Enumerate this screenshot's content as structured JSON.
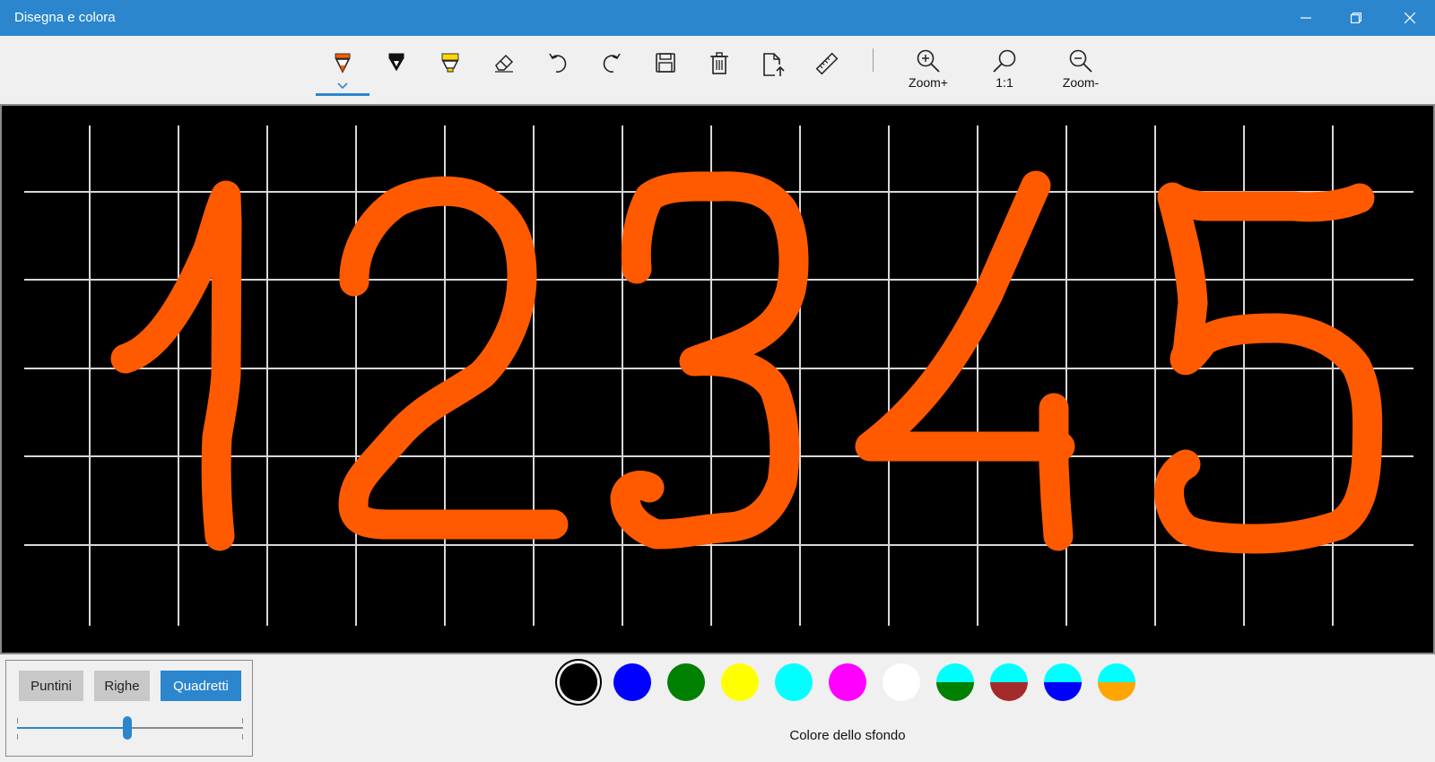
{
  "window": {
    "title": "Disegna e colora",
    "minimize_icon": "minimize-icon",
    "maximize_icon": "restore-icon",
    "close_icon": "close-icon"
  },
  "toolbar": {
    "tools": [
      {
        "name": "pen-tool",
        "icon": "orange-pen-icon",
        "active": true
      },
      {
        "name": "marker-tool",
        "icon": "black-marker-icon"
      },
      {
        "name": "highlighter-tool",
        "icon": "yellow-highlighter-icon"
      },
      {
        "name": "eraser-tool",
        "icon": "eraser-icon"
      },
      {
        "name": "undo-tool",
        "icon": "undo-icon"
      },
      {
        "name": "redo-tool",
        "icon": "redo-icon"
      },
      {
        "name": "save-tool",
        "icon": "save-icon"
      },
      {
        "name": "delete-tool",
        "icon": "trash-icon"
      },
      {
        "name": "export-tool",
        "icon": "file-export-icon"
      },
      {
        "name": "ruler-tool",
        "icon": "ruler-icon"
      }
    ],
    "zoom_in_label": "Zoom+",
    "zoom_reset_label": "1:1",
    "zoom_out_label": "Zoom-"
  },
  "canvas": {
    "background": "#000000",
    "grid_color": "#d8d8d8",
    "stroke_color": "#ff5a00",
    "drawn_digits": [
      "1",
      "2",
      "3",
      "4",
      "5"
    ]
  },
  "grid_panel": {
    "buttons": [
      {
        "label": "Puntini",
        "selected": false
      },
      {
        "label": "Righe",
        "selected": false
      },
      {
        "label": "Quadretti",
        "selected": true
      }
    ],
    "grid_size_slider_fraction": 0.49
  },
  "background_colors": {
    "caption": "Colore dello sfondo",
    "selected_index": 0,
    "swatches": [
      {
        "name": "black",
        "top": "#000000",
        "bottom": "#000000"
      },
      {
        "name": "blue",
        "top": "#0000ff",
        "bottom": "#0000ff"
      },
      {
        "name": "green",
        "top": "#008000",
        "bottom": "#008000"
      },
      {
        "name": "yellow",
        "top": "#ffff00",
        "bottom": "#ffff00"
      },
      {
        "name": "cyan",
        "top": "#00ffff",
        "bottom": "#00ffff"
      },
      {
        "name": "magenta",
        "top": "#ff00ff",
        "bottom": "#ff00ff"
      },
      {
        "name": "white",
        "top": "#ffffff",
        "bottom": "#ffffff"
      },
      {
        "name": "cyan-green",
        "top": "#00ffff",
        "bottom": "#008000"
      },
      {
        "name": "cyan-brown",
        "top": "#00ffff",
        "bottom": "#a52a2a"
      },
      {
        "name": "cyan-blue",
        "top": "#00ffff",
        "bottom": "#0000ff"
      },
      {
        "name": "cyan-orange",
        "top": "#00ffff",
        "bottom": "#ffa500"
      }
    ]
  }
}
